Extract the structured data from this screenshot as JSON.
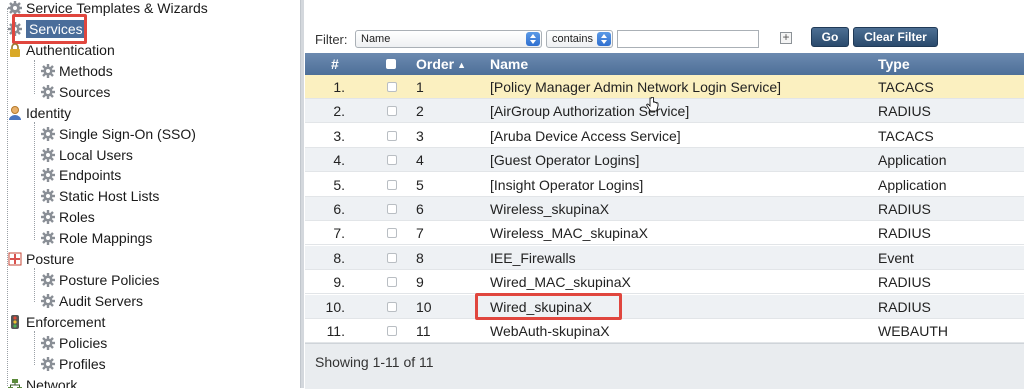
{
  "nav": {
    "items": [
      {
        "label": "Service Templates & Wizards",
        "icon": "gear-icon"
      },
      {
        "label": "Services",
        "icon": "gear-icon"
      },
      {
        "label": "Authentication",
        "icon": "lock-icon"
      },
      {
        "label": "Methods",
        "icon": "gear-icon"
      },
      {
        "label": "Sources",
        "icon": "gear-icon"
      },
      {
        "label": "Identity",
        "icon": "user-icon"
      },
      {
        "label": "Single Sign-On (SSO)",
        "icon": "gear-icon"
      },
      {
        "label": "Local Users",
        "icon": "gear-icon"
      },
      {
        "label": "Endpoints",
        "icon": "gear-icon"
      },
      {
        "label": "Static Host Lists",
        "icon": "gear-icon"
      },
      {
        "label": "Roles",
        "icon": "gear-icon"
      },
      {
        "label": "Role Mappings",
        "icon": "gear-icon"
      },
      {
        "label": "Posture",
        "icon": "posture-icon"
      },
      {
        "label": "Posture Policies",
        "icon": "gear-icon"
      },
      {
        "label": "Audit Servers",
        "icon": "gear-icon"
      },
      {
        "label": "Enforcement",
        "icon": "traffic-light-icon"
      },
      {
        "label": "Policies",
        "icon": "gear-icon"
      },
      {
        "label": "Profiles",
        "icon": "gear-icon"
      },
      {
        "label": "Network",
        "icon": "network-icon"
      }
    ]
  },
  "filter": {
    "label": "Filter:",
    "field_value": "Name",
    "operator_value": "contains",
    "text_value": "",
    "add_symbol": "+",
    "go_label": "Go",
    "clear_label": "Clear Filter"
  },
  "table": {
    "headers": {
      "num": "#",
      "order": "Order",
      "order_sort": "▲",
      "name": "Name",
      "type": "Type"
    },
    "rows": [
      {
        "num": "1.",
        "order": "1",
        "name": "[Policy Manager Admin Network Login Service]",
        "type": "TACACS"
      },
      {
        "num": "2.",
        "order": "2",
        "name": "[AirGroup Authorization Service]",
        "type": "RADIUS"
      },
      {
        "num": "3.",
        "order": "3",
        "name": "[Aruba Device Access Service]",
        "type": "TACACS"
      },
      {
        "num": "4.",
        "order": "4",
        "name": "[Guest Operator Logins]",
        "type": "Application"
      },
      {
        "num": "5.",
        "order": "5",
        "name": "[Insight Operator Logins]",
        "type": "Application"
      },
      {
        "num": "6.",
        "order": "6",
        "name": "Wireless_skupinaX",
        "type": "RADIUS"
      },
      {
        "num": "7.",
        "order": "7",
        "name": "Wireless_MAC_skupinaX",
        "type": "RADIUS"
      },
      {
        "num": "8.",
        "order": "8",
        "name": "IEE_Firewalls",
        "type": "Event"
      },
      {
        "num": "9.",
        "order": "9",
        "name": "Wired_MAC_skupinaX",
        "type": "RADIUS"
      },
      {
        "num": "10.",
        "order": "10",
        "name": "Wired_skupinaX",
        "type": "RADIUS"
      },
      {
        "num": "11.",
        "order": "11",
        "name": "WebAuth-skupinaX",
        "type": "WEBAUTH"
      }
    ],
    "footer": "Showing 1-11 of 11"
  },
  "colors": {
    "highlight": "#e0463e",
    "header": "#4d6f98",
    "selected_row": "#fbf0c0"
  }
}
